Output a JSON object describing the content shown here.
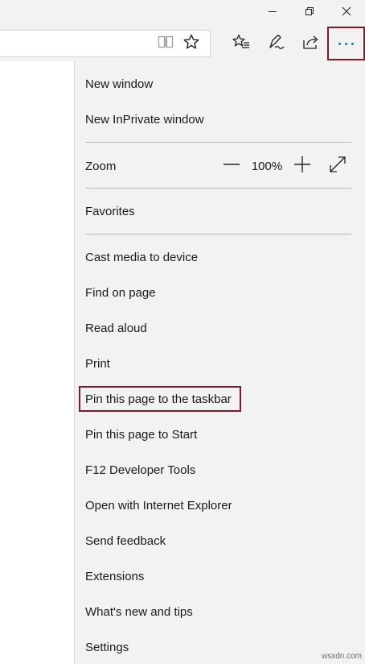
{
  "window": {
    "minimize_icon": "minimize-icon",
    "restore_icon": "restore-icon",
    "close_icon": "close-icon"
  },
  "toolbar": {
    "icons": [
      "reading-view-icon",
      "favorite-star-icon",
      "hub-icon",
      "web-note-icon",
      "share-icon",
      "more-actions-icon"
    ],
    "accent_color": "#0078d7",
    "highlight_color": "#7a1a2a"
  },
  "menu": {
    "new_window": "New window",
    "new_inprivate": "New InPrivate window",
    "zoom_label": "Zoom",
    "zoom_value": "100%",
    "favorites": "Favorites",
    "cast": "Cast media to device",
    "find": "Find on page",
    "read_aloud": "Read aloud",
    "print": "Print",
    "pin_taskbar": "Pin this page to the taskbar",
    "pin_start": "Pin this page to Start",
    "dev_tools": "F12 Developer Tools",
    "open_ie": "Open with Internet Explorer",
    "feedback": "Send feedback",
    "extensions": "Extensions",
    "whats_new": "What's new and tips",
    "settings": "Settings"
  },
  "watermark": "wsxdn.com"
}
